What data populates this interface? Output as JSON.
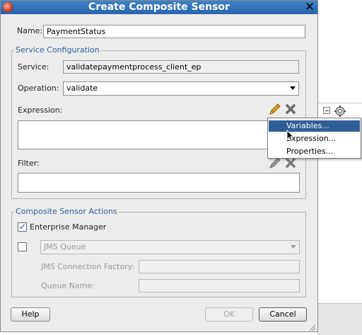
{
  "dialog": {
    "title": "Create Composite Sensor",
    "name_label": "Name:",
    "name_value": "PaymentStatus"
  },
  "service_config": {
    "title": "Service Configuration",
    "service_label": "Service:",
    "service_value": "validatepaymentprocess_client_ep",
    "operation_label": "Operation:",
    "operation_value": "validate",
    "expression_label": "Expression:",
    "expression_value": "",
    "filter_label": "Filter:",
    "filter_value": ""
  },
  "context_menu": {
    "items": [
      {
        "label": "Variables...",
        "selected": true
      },
      {
        "label": "Expression...",
        "selected": false
      },
      {
        "label": "Properties...",
        "selected": false
      }
    ]
  },
  "actions": {
    "title": "Composite Sensor Actions",
    "enterprise_manager_label": "Enterprise Manager",
    "enterprise_manager_checked": true,
    "jms_checked": false,
    "jms_queue_value": "JMS Queue",
    "jms_connection_factory_label": "JMS Connection Factory:",
    "jms_connection_factory_value": "",
    "queue_name_label": "Queue Name:",
    "queue_name_value": ""
  },
  "buttons": {
    "help": "Help",
    "ok": "OK",
    "cancel": "Cancel"
  },
  "colors": {
    "title_bar": "#2a63ad",
    "group_title": "#2f5f96",
    "menu_selection": "#2f5f96",
    "pencil": "#e0a020",
    "delete_x": "#6a6a6a"
  },
  "icons": [
    "app-icon",
    "close-icon",
    "pencil-icon",
    "delete-icon",
    "dropdown-arrow-icon",
    "checkmark-icon",
    "mouse-cursor-icon",
    "resize-grip-icon",
    "gear-icon",
    "collapse-icon"
  ]
}
